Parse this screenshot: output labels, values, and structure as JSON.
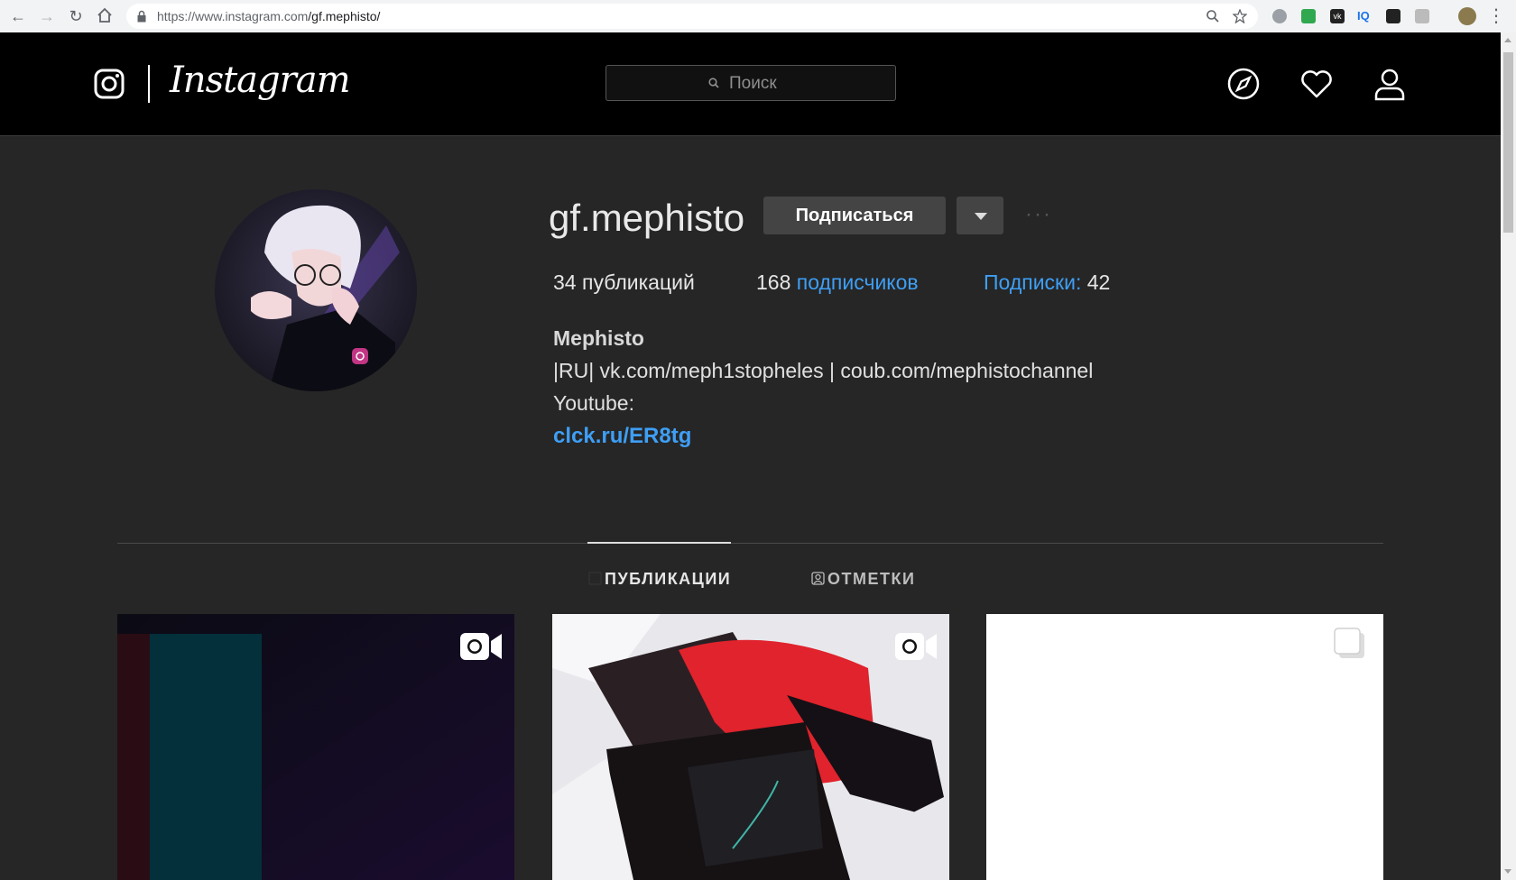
{
  "browser": {
    "url_prefix": "https://www.instagram.com",
    "url_path": "/gf.mephisto/",
    "ext_iq_label": "IQ"
  },
  "header": {
    "logo_text": "Instagram",
    "search_placeholder": "Поиск"
  },
  "profile": {
    "username": "gf.mephisto",
    "follow_label": "Подписаться",
    "more_label": "···",
    "posts_count": "34",
    "posts_label": "публикаций",
    "followers_count": "168",
    "followers_label": "подписчиков",
    "following_label": "Подписки:",
    "following_count": "42",
    "full_name": "Mephisto",
    "bio_lines": [
      "|RU| vk.com/meph1stopheles | coub.com/mephistochannel",
      "Youtube:"
    ],
    "link": "clck.ru/ER8tg"
  },
  "tabs": {
    "posts": "ПУБЛИКАЦИИ",
    "tagged": "ОТМЕТКИ"
  },
  "posts": [
    {
      "type": "video"
    },
    {
      "type": "video"
    },
    {
      "type": "carousel"
    }
  ],
  "colors": {
    "link": "#3e9ff5",
    "background": "#262626",
    "header_bg": "#000000"
  }
}
